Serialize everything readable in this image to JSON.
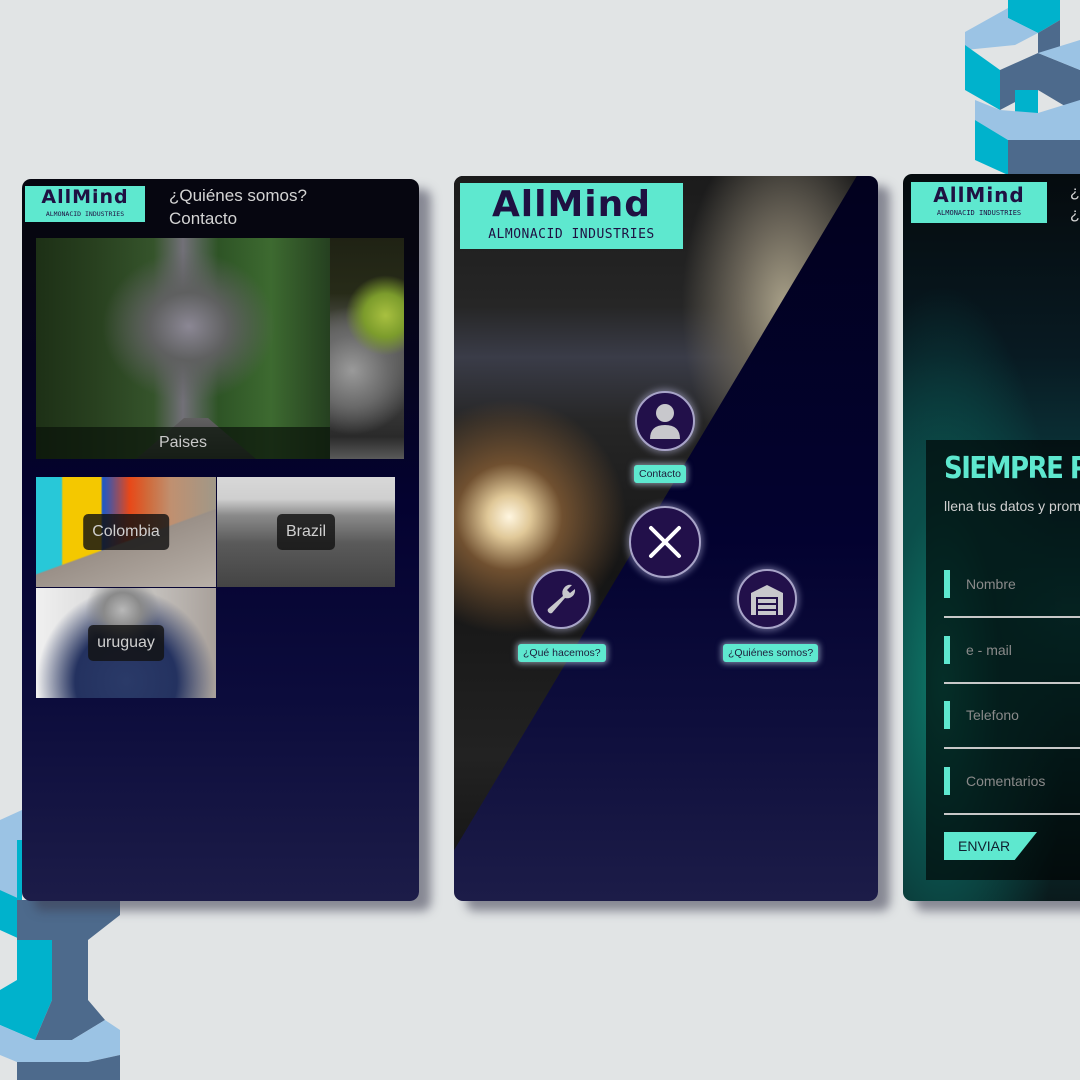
{
  "brand": {
    "logo_mark": "AllMind",
    "logo_sub": "ALMONACID INDUSTRIES",
    "accent": "#5ee8cf",
    "dark_purple": "#22104a"
  },
  "screen1": {
    "nav": [
      "¿Quiénes somos?",
      "Contacto"
    ],
    "hero_caption": "Paises",
    "countries": [
      "Colombia",
      "Brazil",
      "uruguay"
    ]
  },
  "screen2": {
    "menu": {
      "contact_label": "Contacto",
      "what_label": "¿Qué hacemos?",
      "who_label": "¿Quiénes somos?",
      "icons": [
        "user-icon",
        "close-icon",
        "wrench-icon",
        "warehouse-icon"
      ]
    }
  },
  "screen3": {
    "nav": [
      "¿Q",
      "¿Q"
    ],
    "form": {
      "title": "SIEMPRE PU",
      "subtitle": "llena tus datos y prom",
      "fields": [
        {
          "placeholder": "Nombre"
        },
        {
          "placeholder": "e - mail"
        },
        {
          "placeholder": "Telefono"
        },
        {
          "placeholder": "Comentarios"
        }
      ],
      "submit_label": "ENVIAR"
    }
  }
}
